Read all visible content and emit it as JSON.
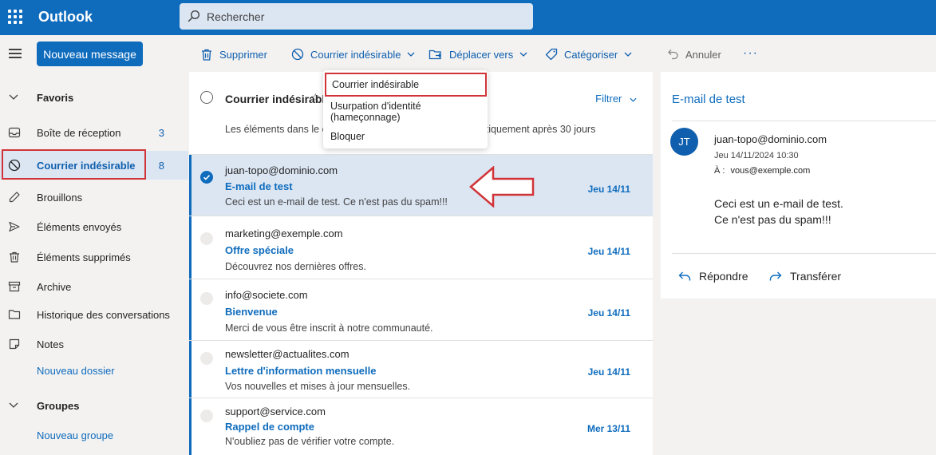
{
  "app": {
    "title": "Outlook"
  },
  "search": {
    "placeholder": "Rechercher"
  },
  "toolbar": {
    "new_message": "Nouveau message",
    "delete": "Supprimer",
    "junk": "Courrier indésirable",
    "move_to": "Déplacer vers",
    "categorize": "Catégoriser",
    "undo": "Annuler",
    "more": "···"
  },
  "nav": {
    "favorites": "Favoris",
    "inbox": {
      "label": "Boîte de réception",
      "count": "3"
    },
    "junk": {
      "label": "Courrier indésirable",
      "count": "8"
    },
    "drafts": "Brouillons",
    "sent": "Éléments envoyés",
    "deleted": "Éléments supprimés",
    "archive": "Archive",
    "history": "Historique des conversations",
    "notes": "Notes",
    "new_folder": "Nouveau dossier",
    "groups": "Groupes",
    "new_group": "Nouveau groupe"
  },
  "list": {
    "folder_title": "Courrier indésirable",
    "star": "☆",
    "filter": "Filtrer",
    "notice_start": "Les éléments dans le co",
    "notice_end": "utomatiquement après 30 jours",
    "messages": [
      {
        "sender": "juan-topo@dominio.com",
        "subject": "E-mail de test",
        "preview": "Ceci est un e-mail de test. Ce n'est pas du spam!!!",
        "date": "Jeu 14/11"
      },
      {
        "sender": "marketing@exemple.com",
        "subject": "Offre spéciale",
        "preview": "Découvrez nos dernières offres.",
        "date": "Jeu 14/11"
      },
      {
        "sender": "info@societe.com",
        "subject": "Bienvenue",
        "preview": "Merci de vous être inscrit à notre communauté.",
        "date": "Jeu 14/11"
      },
      {
        "sender": "newsletter@actualites.com",
        "subject": "Lettre d'information mensuelle",
        "preview": "Vos nouvelles et mises à jour mensuelles.",
        "date": "Jeu 14/11"
      },
      {
        "sender": "support@service.com",
        "subject": "Rappel de compte",
        "preview": "N'oubliez pas de vérifier votre compte.",
        "date": "Mer 13/11"
      }
    ]
  },
  "dropdown": {
    "items": [
      "Courrier indésirable",
      "Usurpation d'identité (hameçonnage)",
      "Bloquer"
    ]
  },
  "reading": {
    "title": "E-mail de test",
    "avatar": "JT",
    "from": "juan-topo@dominio.com",
    "date": "Jeu 14/11/2024 10:30",
    "to_label": "À :",
    "to": "vous@exemple.com",
    "body_line1": "Ceci est un e-mail de test.",
    "body_line2": "Ce n'est pas du spam!!!",
    "reply": "Répondre",
    "forward": "Transférer"
  },
  "colors": {
    "brand": "#0f6cbd",
    "selected_bg": "#dce6f3",
    "highlight": "#d13438"
  }
}
